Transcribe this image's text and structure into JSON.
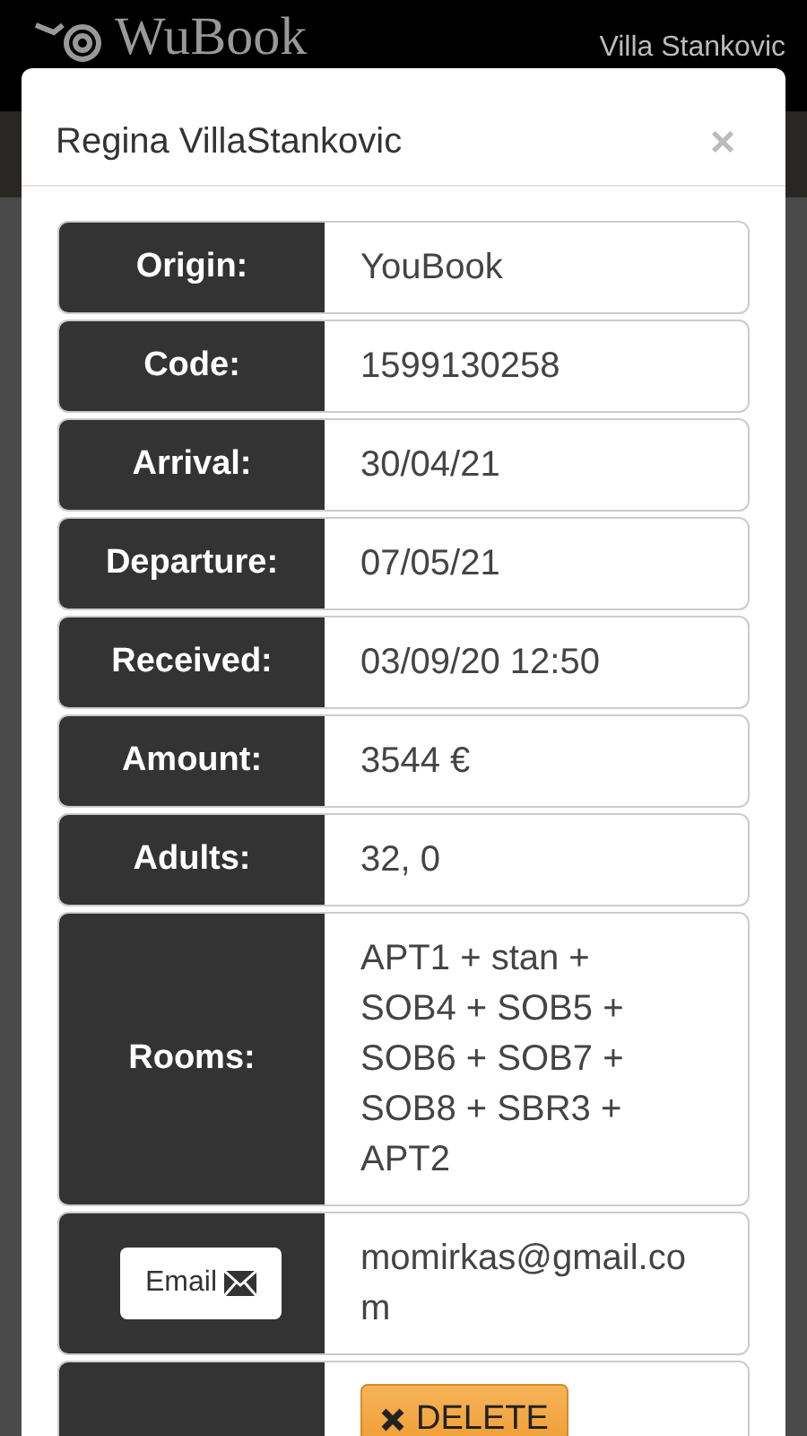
{
  "header": {
    "logo": "WuBook",
    "property": "Villa Stankovic"
  },
  "modal": {
    "title": "Regina VillaStankovic",
    "close": "×",
    "rows": [
      {
        "kind": "text",
        "label": "Origin:",
        "value": "YouBook"
      },
      {
        "kind": "text",
        "label": "Code:",
        "value": "1599130258"
      },
      {
        "kind": "text",
        "label": "Arrival:",
        "value": "30/04/21"
      },
      {
        "kind": "text",
        "label": "Departure:",
        "value": "07/05/21"
      },
      {
        "kind": "text",
        "label": "Received:",
        "value": "03/09/20 12:50"
      },
      {
        "kind": "text",
        "label": "Amount:",
        "value": "3544 €"
      },
      {
        "kind": "text",
        "label": "Adults:",
        "value": "32, 0"
      },
      {
        "kind": "text",
        "label": "Rooms:",
        "value": "APT1 + stan + SOB4 + SOB5 + SOB6 + SOB7 + SOB8 + SBR3 + APT2"
      },
      {
        "kind": "email",
        "button": "Email",
        "value": "momirkas@gmail.com"
      },
      {
        "kind": "action",
        "button": "DELETE"
      }
    ]
  }
}
